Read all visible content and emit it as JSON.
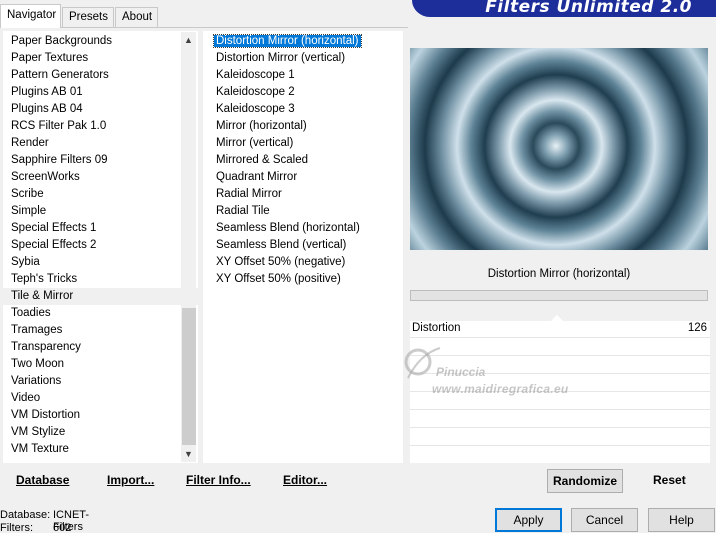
{
  "tabs": [
    {
      "label": "Navigator"
    },
    {
      "label": "Presets"
    },
    {
      "label": "About"
    }
  ],
  "banner": {
    "title": "Filters Unlimited 2.0"
  },
  "categories": [
    "Paper Backgrounds",
    "Paper Textures",
    "Pattern Generators",
    "Plugins AB 01",
    "Plugins AB 04",
    "RCS Filter Pak 1.0",
    "Render",
    "Sapphire Filters 09",
    "ScreenWorks",
    "Scribe",
    "Simple",
    "Special Effects 1",
    "Special Effects 2",
    "Sybia",
    "Teph's Tricks",
    "Tile & Mirror",
    "Toadies",
    "Tramages",
    "Transparency",
    "Two Moon",
    "Variations",
    "Video",
    "VM Distortion",
    "VM Stylize",
    "VM Texture"
  ],
  "filters": [
    "Distortion Mirror (horizontal)",
    "Distortion Mirror (vertical)",
    "Kaleidoscope 1",
    "Kaleidoscope 2",
    "Kaleidoscope 3",
    "Mirror (horizontal)",
    "Mirror (vertical)",
    "Mirrored & Scaled",
    "Quadrant Mirror",
    "Radial Mirror",
    "Radial Tile",
    "Seamless Blend (horizontal)",
    "Seamless Blend (vertical)",
    "XY Offset 50% (negative)",
    "XY Offset 50% (positive)"
  ],
  "scroll_arrows": {
    "up": "▲",
    "down": "▼"
  },
  "selected_filter_index": 0,
  "current_category_index": 15,
  "params": {
    "title": "Distortion Mirror (horizontal)",
    "label": "Distortion",
    "value": "126"
  },
  "watermark": {
    "name": "Pinuccia",
    "url": "www.maidiregrafica.eu"
  },
  "links": {
    "database": "Database",
    "import": "Import...",
    "filter_info": "Filter Info...",
    "editor": "Editor..."
  },
  "buttons": {
    "randomize": "Randomize",
    "reset": "Reset",
    "apply": "Apply",
    "cancel": "Cancel",
    "help": "Help"
  },
  "status": {
    "db_label": "Database:",
    "db_value": "ICNET-Filters",
    "filters_label": "Filters:",
    "filters_value": "602"
  },
  "colors": {
    "banner": "#1d2d9a",
    "selection": "#0078d7"
  }
}
